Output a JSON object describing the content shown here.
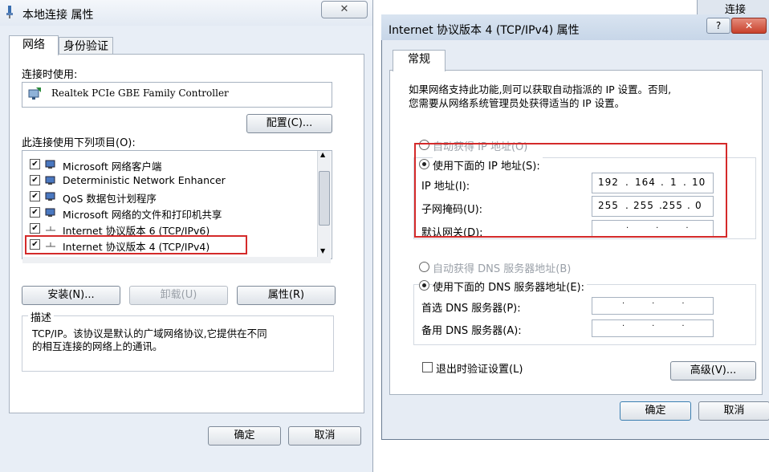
{
  "left_window": {
    "title": "本地连接 属性",
    "close_label": "✕",
    "tabs": [
      "网络",
      "身份验证"
    ],
    "connect_using_label": "连接时使用:",
    "adapter_name": "Realtek PCIe GBE Family Controller",
    "configure_button": "配置(C)...",
    "items_label": "此连接使用下列项目(O):",
    "items": [
      {
        "label": "Microsoft 网络客户端",
        "checked": true
      },
      {
        "label": "Deterministic Network Enhancer",
        "checked": true
      },
      {
        "label": "QoS 数据包计划程序",
        "checked": true
      },
      {
        "label": "Microsoft 网络的文件和打印机共享",
        "checked": true
      },
      {
        "label": "Internet 协议版本 6 (TCP/IPv6)",
        "checked": true
      },
      {
        "label": "Internet 协议版本 4 (TCP/IPv4)",
        "checked": true
      }
    ],
    "install_button": "安装(N)...",
    "uninstall_button": "卸载(U)",
    "properties_button": "属性(R)",
    "description_label": "描述",
    "description_text_line1": "TCP/IP。该协议是默认的广域网络协议,它提供在不同",
    "description_text_line2": "的相互连接的网络上的通讯。",
    "ok_button": "确定",
    "cancel_button": "取消"
  },
  "right_window": {
    "title": "Internet 协议版本 4 (TCP/IPv4) 属性",
    "help_label": "?",
    "close_label": "✕",
    "tab": "常规",
    "intro_line1": "如果网络支持此功能,则可以获取自动指派的 IP 设置。否则,",
    "intro_line2": "您需要从网络系统管理员处获得适当的 IP 设置。",
    "auto_ip_label": "自动获得 IP 地址(O)",
    "manual_ip_label": "使用下面的 IP 地址(S):",
    "ip_address_label": "IP 地址(I):",
    "ip_address_value": [
      "192",
      "164",
      "1",
      "10"
    ],
    "subnet_label": "子网掩码(U):",
    "subnet_value": [
      "255",
      "255",
      "255",
      "0"
    ],
    "gateway_label": "默认网关(D):",
    "auto_dns_label": "自动获得 DNS 服务器地址(B)",
    "manual_dns_label": "使用下面的 DNS 服务器地址(E):",
    "preferred_dns_label": "首选 DNS 服务器(P):",
    "alternate_dns_label": "备用 DNS 服务器(A):",
    "validate_label": "退出时验证设置(L)",
    "advanced_button": "高级(V)...",
    "ok_button": "确定",
    "cancel_button": "取消"
  },
  "background": {
    "partial_label": "连接"
  }
}
